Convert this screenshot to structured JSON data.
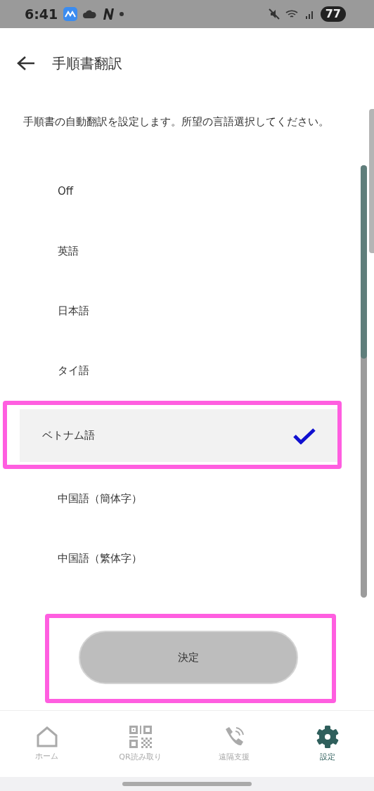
{
  "status_bar": {
    "time": "6:41",
    "battery": "77"
  },
  "header": {
    "title": "手順書翻訳"
  },
  "description": "手順書の自動翻訳を設定します。所望の言語選択してください。",
  "options": [
    {
      "label": "Off",
      "selected": false,
      "highlighted": false
    },
    {
      "label": "英語",
      "selected": false,
      "highlighted": false
    },
    {
      "label": "日本語",
      "selected": false,
      "highlighted": false
    },
    {
      "label": "タイ語",
      "selected": false,
      "highlighted": false
    },
    {
      "label": "ベトナム語",
      "selected": true,
      "highlighted": true
    },
    {
      "label": "中国語（簡体字）",
      "selected": false,
      "highlighted": false
    },
    {
      "label": "中国語（繁体字）",
      "selected": false,
      "highlighted": false
    }
  ],
  "confirm_button": {
    "label": "決定",
    "disabled": true,
    "highlighted": true
  },
  "bottom_nav": [
    {
      "kind": "home",
      "label": "ホーム",
      "selected": false
    },
    {
      "kind": "qr",
      "label": "QR読み取り",
      "selected": false
    },
    {
      "kind": "call",
      "label": "遠隔支援",
      "selected": false
    },
    {
      "kind": "settings",
      "label": "設定",
      "selected": true
    }
  ]
}
